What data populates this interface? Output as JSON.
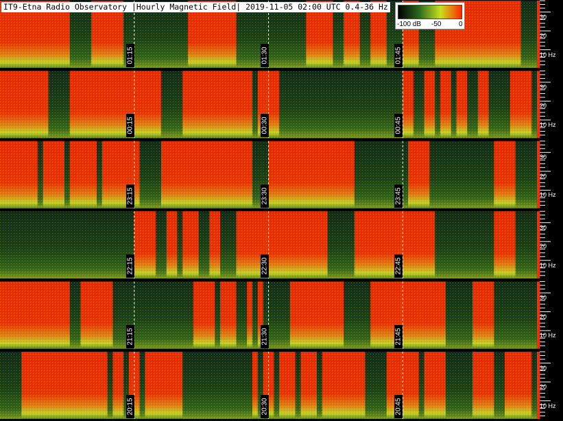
{
  "title": "IT9-Etna Radio Observatory |Hourly Magnetic Field| 2019-11-05 02:00 UTC 0.4-36 Hz",
  "colorbar": {
    "ticks": [
      "-100 dB",
      "-50",
      "0"
    ],
    "values": [
      -100,
      -50,
      0
    ],
    "colors": [
      "#000000",
      "#2d6a1e",
      "#c8e01e",
      "#ff2a00"
    ]
  },
  "chart_data": {
    "type": "heatmap",
    "title": "IT9-Etna Radio Observatory |Hourly Magnetic Field| 2019-11-05 02:00 UTC 0.4-36 Hz",
    "xlabel": "",
    "ylabel": "",
    "y_unit": "Hz",
    "ylim": [
      0.4,
      36
    ],
    "y_ticks": [
      "30",
      "20",
      "10 Hz"
    ],
    "y_tick_values": [
      30,
      20,
      10
    ],
    "color_range_db": [
      -100,
      0
    ],
    "rows": [
      {
        "hour": "01",
        "time_marks": [
          "01:15",
          "01:30",
          "01:45"
        ],
        "loud": [
          [
            0.0,
            0.13
          ],
          [
            0.17,
            0.23
          ],
          [
            0.35,
            0.44
          ],
          [
            0.57,
            0.62
          ],
          [
            0.64,
            0.67
          ],
          [
            0.69,
            0.72
          ],
          [
            0.75,
            0.78
          ],
          [
            0.81,
            0.97
          ]
        ]
      },
      {
        "hour": "00",
        "time_marks": [
          "00:15",
          "00:30",
          "00:45"
        ],
        "loud": [
          [
            0.0,
            0.09
          ],
          [
            0.13,
            0.3
          ],
          [
            0.34,
            0.47
          ],
          [
            0.48,
            0.52
          ],
          [
            0.75,
            0.77
          ],
          [
            0.79,
            0.81
          ],
          [
            0.82,
            0.84
          ],
          [
            0.85,
            0.87
          ],
          [
            0.89,
            0.91
          ],
          [
            0.95,
            0.99
          ]
        ]
      },
      {
        "hour": "23",
        "time_marks": [
          "23:15",
          "23:30",
          "23:45"
        ],
        "loud": [
          [
            0.0,
            0.07
          ],
          [
            0.08,
            0.12
          ],
          [
            0.13,
            0.18
          ],
          [
            0.19,
            0.26
          ],
          [
            0.3,
            0.47
          ],
          [
            0.5,
            0.66
          ],
          [
            0.76,
            0.8
          ],
          [
            0.92,
            0.96
          ]
        ]
      },
      {
        "hour": "22",
        "time_marks": [
          "22:15",
          "22:30",
          "22:45"
        ],
        "loud": [
          [
            0.25,
            0.29
          ],
          [
            0.31,
            0.33
          ],
          [
            0.34,
            0.37
          ],
          [
            0.39,
            0.41
          ],
          [
            0.44,
            0.61
          ],
          [
            0.66,
            0.81
          ],
          [
            0.92,
            0.96
          ]
        ]
      },
      {
        "hour": "21",
        "time_marks": [
          "21:15",
          "21:30",
          "21:45"
        ],
        "loud": [
          [
            0.0,
            0.13
          ],
          [
            0.15,
            0.18
          ],
          [
            0.18,
            0.21
          ],
          [
            0.36,
            0.4
          ],
          [
            0.41,
            0.44
          ],
          [
            0.46,
            0.47
          ],
          [
            0.48,
            0.49
          ],
          [
            0.54,
            0.64
          ],
          [
            0.69,
            0.83
          ],
          [
            0.88,
            0.92
          ]
        ]
      },
      {
        "hour": "20",
        "time_marks": [
          "20:15",
          "20:30",
          "20:45"
        ],
        "loud": [
          [
            0.04,
            0.2
          ],
          [
            0.21,
            0.23
          ],
          [
            0.24,
            0.26
          ],
          [
            0.27,
            0.34
          ],
          [
            0.47,
            0.48
          ],
          [
            0.49,
            0.51
          ],
          [
            0.52,
            0.55
          ],
          [
            0.56,
            0.59
          ],
          [
            0.6,
            0.68
          ],
          [
            0.72,
            0.78
          ],
          [
            0.79,
            0.83
          ],
          [
            0.88,
            0.92
          ],
          [
            0.94,
            0.99
          ]
        ]
      }
    ]
  }
}
